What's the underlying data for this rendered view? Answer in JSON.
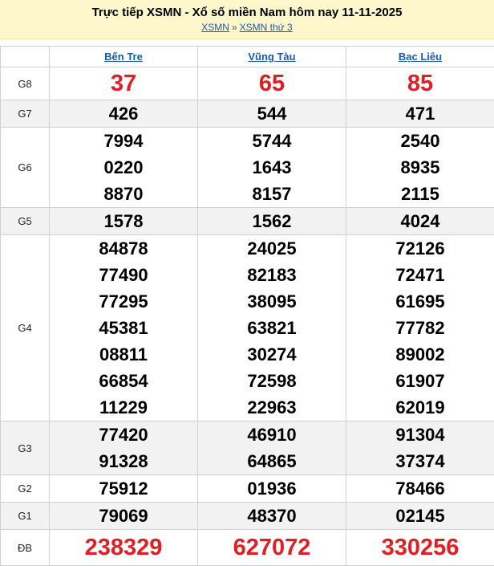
{
  "header": {
    "title": "Trực tiếp XSMN - Xổ số miền Nam hôm nay 11-11-2025",
    "breadcrumb": [
      "XSMN",
      "XSMN thứ 3"
    ],
    "breadcrumb_sep": "»"
  },
  "provinces": [
    "Bến Tre",
    "Vũng Tàu",
    "Bạc Liêu"
  ],
  "prizes": [
    {
      "label": "G8",
      "values": [
        [
          "37"
        ],
        [
          "65"
        ],
        [
          "85"
        ]
      ]
    },
    {
      "label": "G7",
      "values": [
        [
          "426"
        ],
        [
          "544"
        ],
        [
          "471"
        ]
      ]
    },
    {
      "label": "G6",
      "values": [
        [
          "7994",
          "0220",
          "8870"
        ],
        [
          "5744",
          "1643",
          "8157"
        ],
        [
          "2540",
          "8935",
          "2115"
        ]
      ]
    },
    {
      "label": "G5",
      "values": [
        [
          "1578"
        ],
        [
          "1562"
        ],
        [
          "4024"
        ]
      ]
    },
    {
      "label": "G4",
      "values": [
        [
          "84878",
          "77490",
          "77295",
          "45381",
          "08811",
          "66854",
          "11229"
        ],
        [
          "24025",
          "82183",
          "38095",
          "63821",
          "30274",
          "72598",
          "22963"
        ],
        [
          "72126",
          "72471",
          "61695",
          "77782",
          "89002",
          "61907",
          "62019"
        ]
      ]
    },
    {
      "label": "G3",
      "values": [
        [
          "77420",
          "91328"
        ],
        [
          "46910",
          "64865"
        ],
        [
          "91304",
          "37374"
        ]
      ]
    },
    {
      "label": "G2",
      "values": [
        [
          "75912"
        ],
        [
          "01936"
        ],
        [
          "78466"
        ]
      ]
    },
    {
      "label": "G1",
      "values": [
        [
          "79069"
        ],
        [
          "48370"
        ],
        [
          "02145"
        ]
      ]
    },
    {
      "label": "ĐB",
      "values": [
        [
          "238329"
        ],
        [
          "627072"
        ],
        [
          "330256"
        ]
      ]
    }
  ],
  "colors": {
    "accent_red": "#e21d24",
    "link_blue": "#1a5aa6",
    "header_bg": "#fff7cc"
  }
}
